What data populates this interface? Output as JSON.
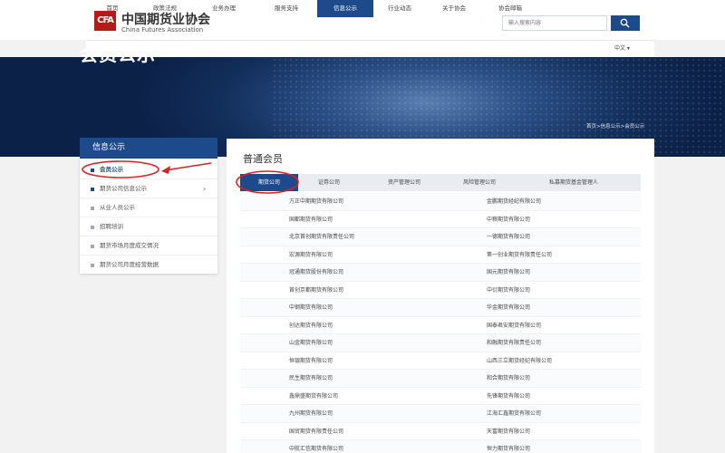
{
  "header": {
    "logo_mark": "CFA",
    "logo_cn": "中国期货业协会",
    "logo_en": "China Futures Association",
    "search_placeholder": "输入搜索内容"
  },
  "nav": {
    "items": [
      "首页",
      "政策法规",
      "业务办理",
      "服务支持",
      "信息公示",
      "行业动态",
      "关于协会",
      "协会邮箱"
    ],
    "active": "信息公示",
    "lang": "中文 ▾"
  },
  "banner": {
    "title": "会员公示",
    "breadcrumb": "首页>信息公示>会员公示"
  },
  "sidebar": {
    "heading": "信息公示",
    "items": [
      {
        "label": "会员公示"
      },
      {
        "label": "期货公司信息公示"
      },
      {
        "label": "从业人员公示"
      },
      {
        "label": "招聘培训"
      },
      {
        "label": "期货市场月度成交情况"
      },
      {
        "label": "期货公司月度经营数据"
      }
    ]
  },
  "main": {
    "title": "普通会员",
    "tabs": [
      "期货公司",
      "证券公司",
      "资产管理公司",
      "风险管理公司",
      "私募期货基金管理人"
    ],
    "rows": [
      {
        "left": "方正中期期货有限公司",
        "right": "金鹏期货经纪有限公司"
      },
      {
        "left": "国都期货有限公司",
        "right": "中粮期货有限公司"
      },
      {
        "left": "北京首创期货有限责任公司",
        "right": "一德期货有限公司"
      },
      {
        "left": "宏源期货有限公司",
        "right": "第一创业期货有限责任公司"
      },
      {
        "left": "冠通期货股份有限公司",
        "right": "国元期货有限公司"
      },
      {
        "left": "首创京都期货有限公司",
        "right": "中衍期货有限公司"
      },
      {
        "left": "中钢期货有限公司",
        "right": "华金期货有限公司"
      },
      {
        "left": "创达期货有限公司",
        "right": "国泰君安期货有限公司"
      },
      {
        "left": "山金期货有限公司",
        "right": "和融期货有限责任公司"
      },
      {
        "left": "恒银期货有限公司",
        "right": "山西三立期货经纪有限公司"
      },
      {
        "left": "民生期货有限公司",
        "right": "和合期货有限公司"
      },
      {
        "left": "鑫鼎盛期货有限公司",
        "right": "先锋期货有限公司"
      },
      {
        "left": "九州期货有限公司",
        "right": "江海汇鑫期货有限公司"
      },
      {
        "left": "国贸期货有限责任公司",
        "right": "天富期货有限公司"
      },
      {
        "left": "中航汇信期货有限公司",
        "right": "恒力期货有限公司"
      }
    ]
  },
  "colors": {
    "brand_blue": "#1c4a8a",
    "logo_red": "#b31b1b",
    "annotation_red": "#e02020"
  }
}
